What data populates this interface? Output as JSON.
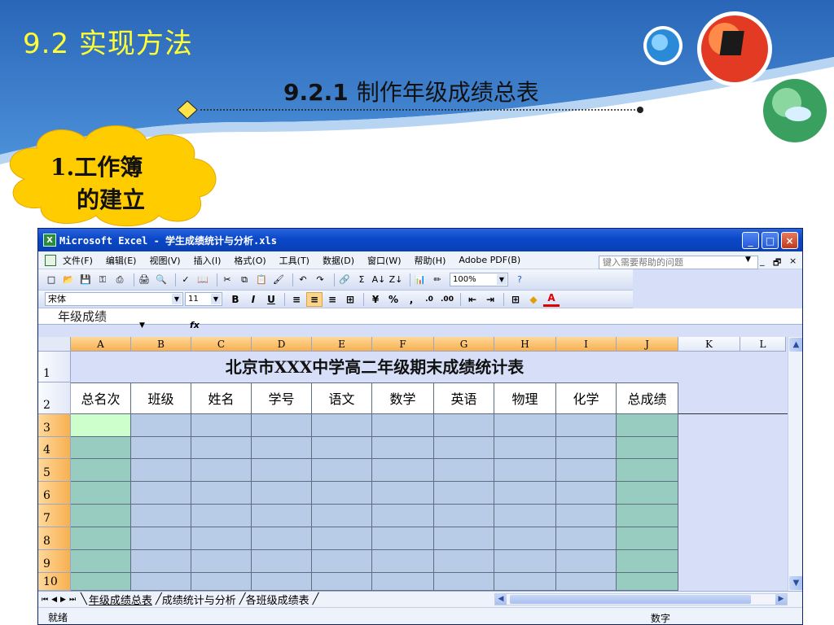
{
  "slide": {
    "title": "9.2  实现方法",
    "subtitle_num": "9.2.1",
    "subtitle_text": "制作年级成绩总表",
    "callout_line1": "1.工作簿",
    "callout_line2": "的建立"
  },
  "colors": {
    "banner_blue": "#3a78c8",
    "title_yellow": "#ffff33",
    "cloud_yellow": "#ffcc00",
    "header_blue": "#0a48c8",
    "cell_blue": "#b8cce8",
    "cell_teal": "#99ccc0",
    "cell_selected": "#ccffcc",
    "selected_header": "#f7b050"
  },
  "window": {
    "title": "Microsoft Excel - 学生成绩统计与分析.xls",
    "app_icon": "X",
    "controls": [
      "_",
      "□",
      "×"
    ]
  },
  "menu": {
    "items": [
      "文件(F)",
      "编辑(E)",
      "视图(V)",
      "插入(I)",
      "格式(O)",
      "工具(T)",
      "数据(D)",
      "窗口(W)",
      "帮助(H)",
      "Adobe PDF(B)"
    ],
    "help_placeholder": "键入需要帮助的问题",
    "mdi_controls": [
      "_",
      "🗗",
      "×"
    ]
  },
  "toolbar": {
    "zoom": "100%",
    "icons": [
      "new-icon",
      "open-icon",
      "save-icon",
      "permission-icon",
      "print-preview-icon",
      "print-icon",
      "preview-icon",
      "spelling-icon",
      "research-icon",
      "cut-icon",
      "copy-icon",
      "paste-icon",
      "format-painter-icon",
      "undo-icon",
      "redo-icon",
      "hyperlink-icon",
      "autosum-icon",
      "sort-asc-icon",
      "sort-desc-icon",
      "chart-icon",
      "drawing-icon"
    ],
    "icon_glyphs": [
      "□",
      "📂",
      "💾",
      "⚿",
      "⎙",
      "🖨",
      "🔍",
      "✓",
      "📖",
      "✂",
      "⧉",
      "📋",
      "🖌",
      "↶",
      "↷",
      "🔗",
      "Σ",
      "A↓",
      "Z↓",
      "📊",
      "✏"
    ]
  },
  "format_bar": {
    "font": "宋体",
    "size": "11",
    "bold": "B",
    "italic": "I",
    "underline": "U",
    "percent": "%",
    "comma": ",",
    "font_color": "A"
  },
  "formula_bar": {
    "name_box": "年级成绩",
    "fx": "fx"
  },
  "sheet": {
    "columns": [
      "A",
      "B",
      "C",
      "D",
      "E",
      "F",
      "G",
      "H",
      "I",
      "J",
      "K",
      "L"
    ],
    "rows": [
      "1",
      "2",
      "3",
      "4",
      "5",
      "6",
      "7",
      "8",
      "9",
      "10"
    ],
    "title": "北京市XXX中学高二年级期末成绩统计表",
    "headers": [
      "总名次",
      "班级",
      "姓名",
      "学号",
      "语文",
      "数学",
      "英语",
      "物理",
      "化学",
      "总成绩"
    ]
  },
  "tabs": [
    "年级成绩总表",
    "成绩统计与分析",
    "各班级成绩表"
  ],
  "status": {
    "left": "就绪",
    "right": "数字"
  }
}
